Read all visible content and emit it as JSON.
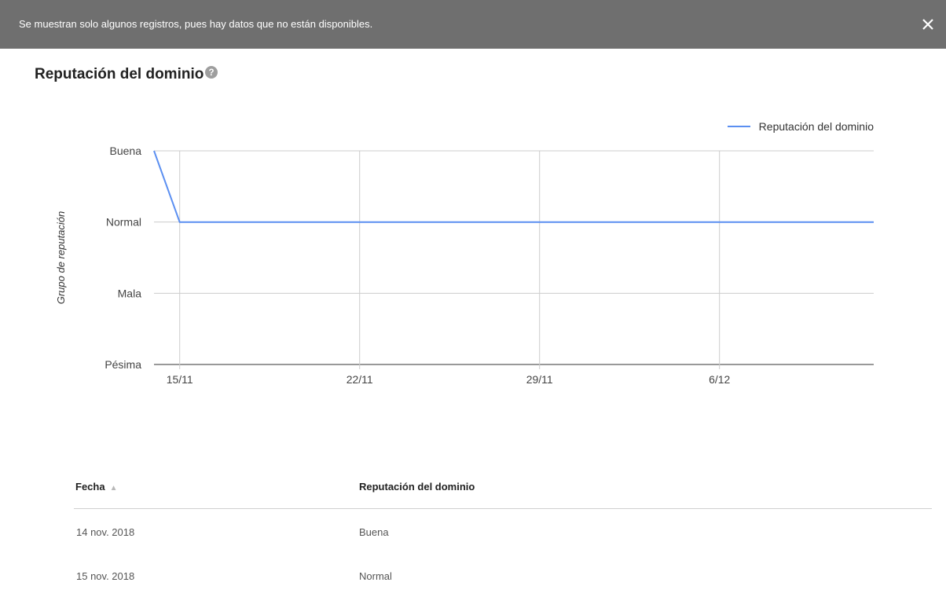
{
  "banner": {
    "message": "Se muestran solo algunos registros, pues hay datos que no están disponibles.",
    "close_icon": "close-icon"
  },
  "page": {
    "title": "Reputación del dominio",
    "help_icon": "help-icon"
  },
  "chart_data": {
    "type": "line",
    "title": "",
    "xlabel": "",
    "ylabel": "Grupo de reputación",
    "y_categories": [
      "Pésima",
      "Mala",
      "Normal",
      "Buena"
    ],
    "x_ticks": [
      "15/11",
      "22/11",
      "29/11",
      "6/12"
    ],
    "x_range": [
      "2018-11-14",
      "2018-12-12"
    ],
    "grid": true,
    "legend_position": "top-right",
    "series": [
      {
        "name": "Reputación del dominio",
        "color": "#5b8ff1",
        "points": [
          {
            "x": "2018-11-14",
            "y": "Buena"
          },
          {
            "x": "2018-11-15",
            "y": "Normal"
          },
          {
            "x": "2018-12-12",
            "y": "Normal"
          }
        ]
      }
    ]
  },
  "table": {
    "columns": [
      "Fecha",
      "Reputación del dominio"
    ],
    "rows": [
      [
        "14 nov. 2018",
        "Buena"
      ],
      [
        "15 nov. 2018",
        "Normal"
      ]
    ]
  }
}
